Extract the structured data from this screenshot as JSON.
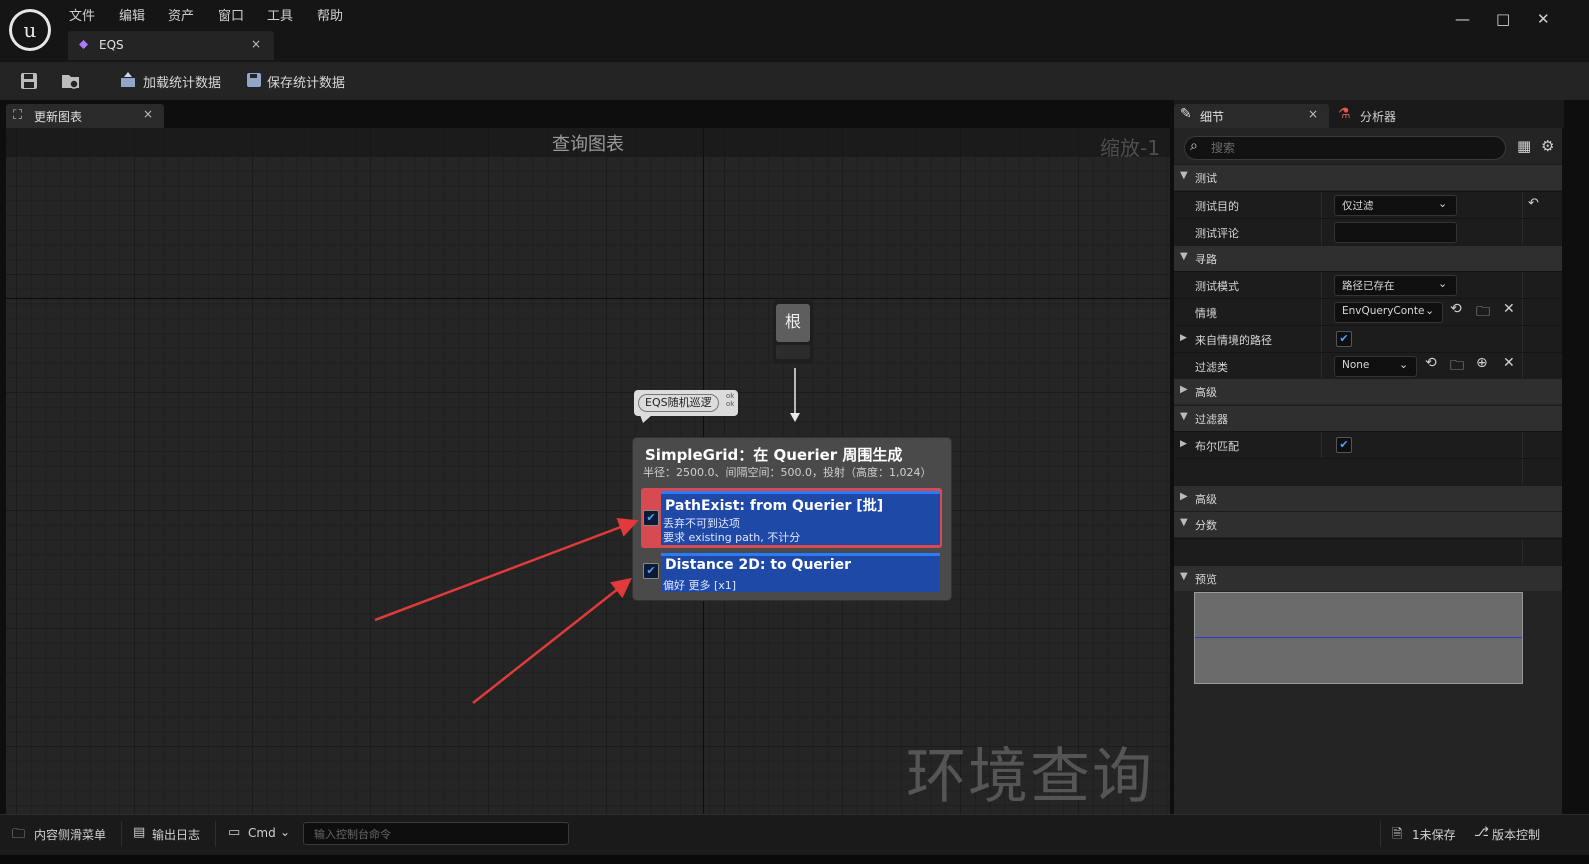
{
  "menu": [
    "文件",
    "编辑",
    "资产",
    "窗口",
    "工具",
    "帮助"
  ],
  "document_tab": {
    "label": "EQS",
    "close": "×"
  },
  "window_controls": {
    "minimize": "—",
    "maximize": "□",
    "close": "✕"
  },
  "toolbar": {
    "load_stats": "加载统计数据",
    "save_stats": "保存统计数据"
  },
  "graph_tab": {
    "label": "更新图表",
    "close": "×"
  },
  "graph": {
    "title": "查询图表",
    "zoom": "缩放-1",
    "watermark": "环境查询",
    "root_node": "根",
    "comment": "EQS随机巡逻",
    "comment_side": "ok\nok",
    "generator": {
      "title": "SimpleGrid：在 Querier 周围生成",
      "subtitle": "半径：2500.0、间隔空间：500.0，投射（高度：1,024）"
    },
    "tests": [
      {
        "title": "PathExist: from Querier [批]",
        "line1": "丢弃不可到达项",
        "line2": "要求 existing path, 不计分",
        "checked": true,
        "highlight_color": "#d84a52"
      },
      {
        "title": "Distance 2D: to Querier",
        "line1": "偏好 更多 [x1]",
        "checked": true
      }
    ]
  },
  "details": {
    "tab_label": "细节",
    "tab_close": "×",
    "profiler_label": "分析器",
    "search_placeholder": "搜索",
    "sections": {
      "test": "测试",
      "pathfinding": "寻路",
      "advanced": "高级",
      "filter": "过滤器",
      "advanced2": "高级",
      "score": "分数",
      "preview": "预览"
    },
    "props": {
      "test_purpose": {
        "label": "测试目的",
        "value": "仅过滤"
      },
      "test_comment": {
        "label": "测试评论",
        "value": ""
      },
      "test_mode": {
        "label": "测试模式",
        "value": "路径已存在"
      },
      "context": {
        "label": "情境",
        "value": "EnvQueryContext_Querier"
      },
      "path_from_context": {
        "label": "来自情境的路径",
        "checked": true
      },
      "filter_class": {
        "label": "过滤类",
        "value": "None"
      },
      "bool_match": {
        "label": "布尔匹配",
        "checked": true
      }
    }
  },
  "statusbar": {
    "content_drawer": "内容侧滑菜单",
    "output_log": "输出日志",
    "cmd": "Cmd",
    "console_placeholder": "输入控制台命令",
    "unsaved": "1未保存",
    "source_control": "版本控制"
  },
  "colors": {
    "accent_blue": "#2b7bff",
    "test_card": "#1f49a6",
    "error_red": "#d84a52",
    "arrow": "#e03a3a"
  }
}
